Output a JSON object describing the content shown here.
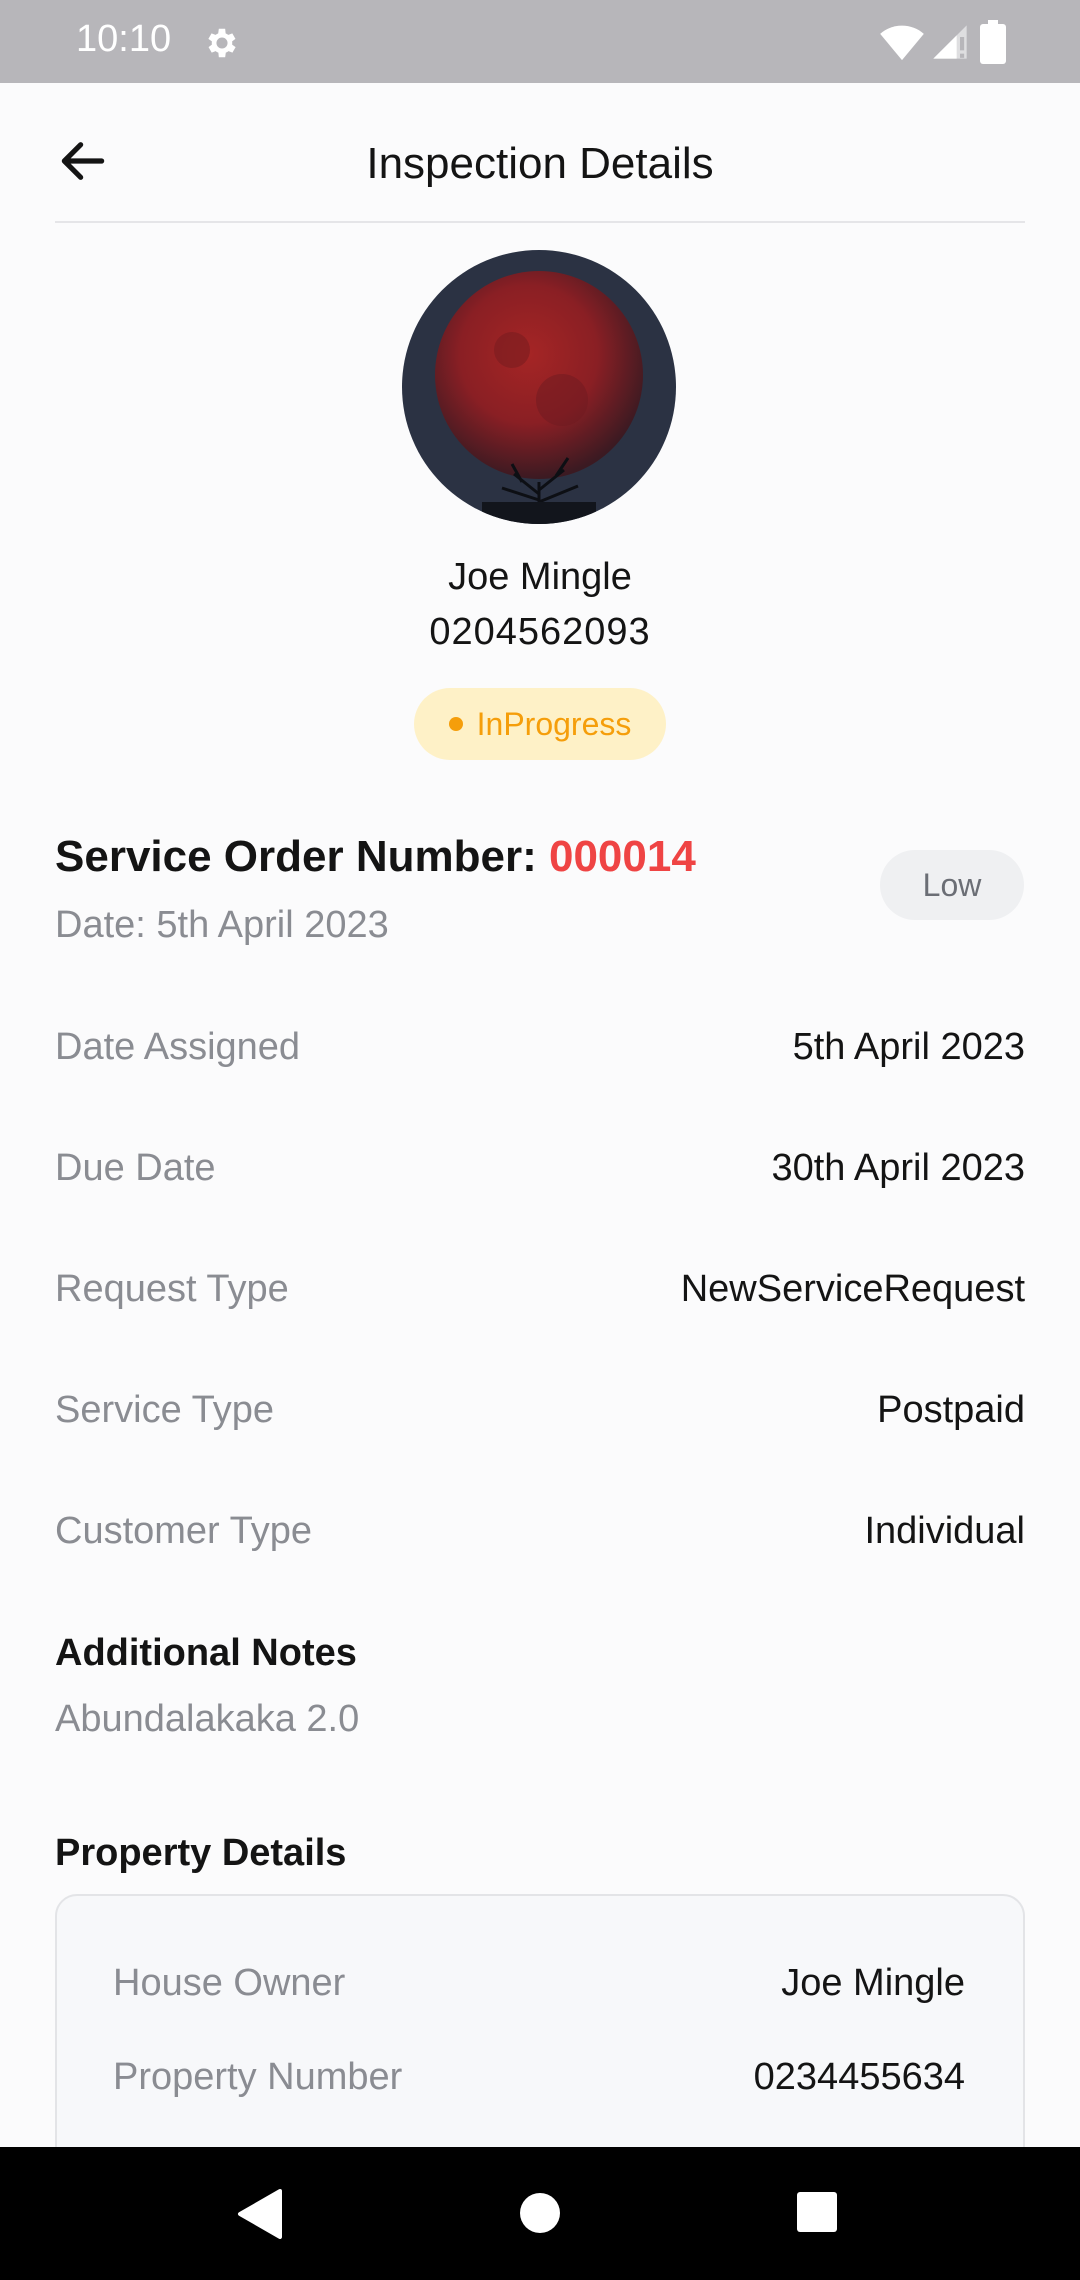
{
  "status_bar": {
    "time": "10:10",
    "icons": [
      "gear-icon",
      "wifi-icon",
      "signal-icon",
      "battery-icon"
    ]
  },
  "header": {
    "title": "Inspection Details",
    "back_icon": "arrow-left-icon"
  },
  "profile": {
    "name": "Joe Mingle",
    "phone": "0204562093",
    "status": "InProgress",
    "status_color": "#F59E0B"
  },
  "service_order": {
    "label": "Service Order Number:",
    "number": "000014",
    "number_color": "#EF4444",
    "date": "Date: 5th April 2023",
    "priority": "Low"
  },
  "details": [
    {
      "label": "Date Assigned",
      "value": "5th April 2023"
    },
    {
      "label": "Due Date",
      "value": "30th April 2023"
    },
    {
      "label": "Request Type",
      "value": "NewServiceRequest"
    },
    {
      "label": "Service Type",
      "value": "Postpaid"
    },
    {
      "label": "Customer Type",
      "value": "Individual"
    }
  ],
  "notes": {
    "title": "Additional Notes",
    "text": "Abundalakaka 2.0"
  },
  "property": {
    "title": "Property Details",
    "rows": [
      {
        "label": "House Owner",
        "value": "Joe Mingle"
      },
      {
        "label": "Property Number",
        "value": "0234455634"
      }
    ]
  },
  "nav": {
    "icons": [
      "nav-back-icon",
      "nav-home-icon",
      "nav-recents-icon"
    ]
  }
}
